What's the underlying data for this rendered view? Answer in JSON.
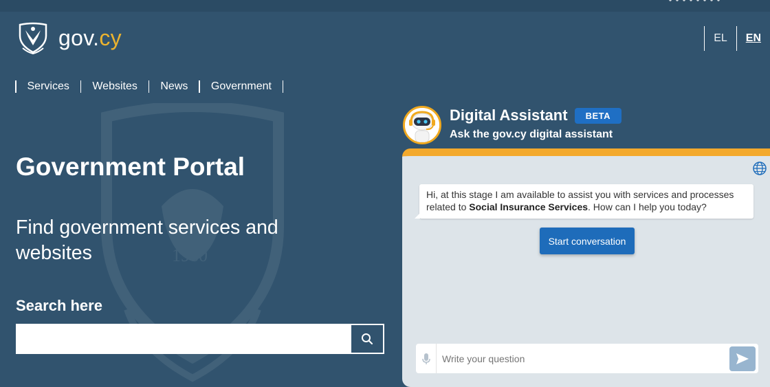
{
  "header": {
    "brand": {
      "prefix": "gov.",
      "suffix": "cy"
    },
    "languages": [
      {
        "label": "EL",
        "active": false
      },
      {
        "label": "EN",
        "active": true
      }
    ]
  },
  "nav": {
    "items": [
      "Services",
      "Websites",
      "News",
      "Government"
    ]
  },
  "hero": {
    "title": "Government Portal",
    "subtitle": "Find government services and websites",
    "search_label": "Search here",
    "search_value": ""
  },
  "assistant": {
    "title": "Digital Assistant",
    "badge": "BETA",
    "subtitle": "Ask the gov.cy digital assistant",
    "message_part1": "Hi, at this stage I am available to assist you with services and processes related to ",
    "message_bold": "Social Insurance Services",
    "message_part2": ". How can I help you today?",
    "start_button": "Start conversation",
    "input_placeholder": "Write your question"
  },
  "colors": {
    "background": "#31536e",
    "accent": "#ebb32f",
    "chat_border": "#f3a92c",
    "primary_button": "#1e6cba",
    "chat_bg": "#dde4e9"
  },
  "icons": [
    "coat-of-arms-icon",
    "search-icon",
    "globe-icon",
    "microphone-icon",
    "send-icon",
    "robot-avatar-icon"
  ]
}
